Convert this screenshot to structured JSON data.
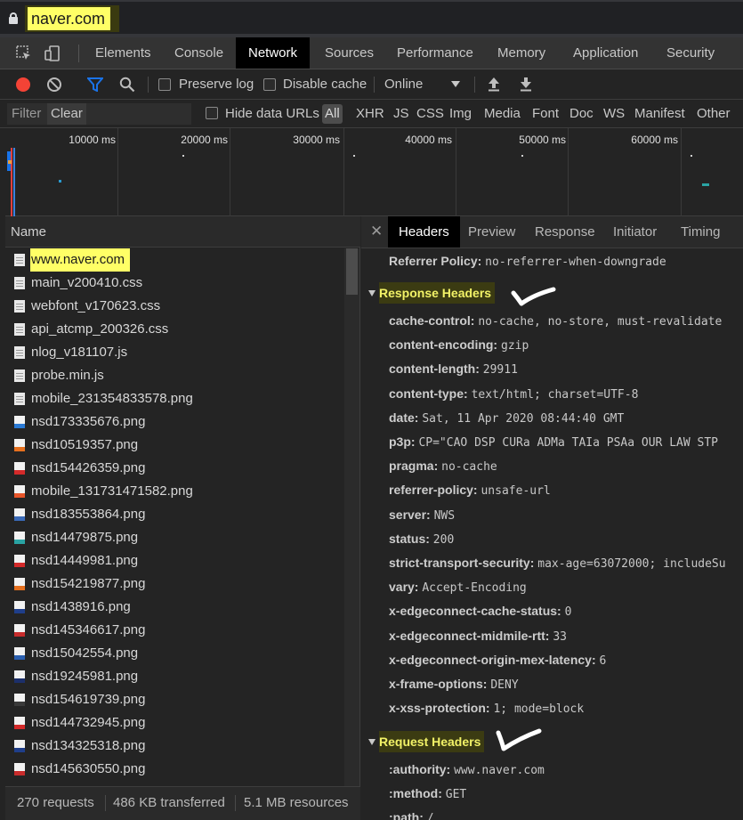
{
  "browser": {
    "url": "naver.com"
  },
  "devtools_tabs": [
    "Elements",
    "Console",
    "Network",
    "Sources",
    "Performance",
    "Memory",
    "Application",
    "Security"
  ],
  "active_tab": "Network",
  "toolbar": {
    "preserve_log": "Preserve log",
    "disable_cache": "Disable cache",
    "throttle": "Online"
  },
  "filter": {
    "placeholder": "Filter",
    "clear": "Clear",
    "hide_data_urls": "Hide data URLs",
    "types": [
      "All",
      "XHR",
      "JS",
      "CSS",
      "Img",
      "Media",
      "Font",
      "Doc",
      "WS",
      "Manifest",
      "Other"
    ],
    "selected": "All"
  },
  "overview": {
    "ticks": [
      "10000 ms",
      "20000 ms",
      "30000 ms",
      "40000 ms",
      "50000 ms",
      "60000 ms"
    ]
  },
  "requests": {
    "column": "Name",
    "items": [
      {
        "name": "www.naver.com",
        "icon": "document-icon"
      },
      {
        "name": "main_v200410.css",
        "icon": "document-icon"
      },
      {
        "name": "webfont_v170623.css",
        "icon": "document-icon"
      },
      {
        "name": "api_atcmp_200326.css",
        "icon": "document-icon"
      },
      {
        "name": "nlog_v181107.js",
        "icon": "document-icon"
      },
      {
        "name": "probe.min.js",
        "icon": "document-icon"
      },
      {
        "name": "mobile_231354833578.png",
        "icon": "document-icon"
      },
      {
        "name": "nsd173335676.png",
        "icon": "image-thumb-icon",
        "color": "#2a7ad5"
      },
      {
        "name": "nsd10519357.png",
        "icon": "image-thumb-icon",
        "color": "#e6701e"
      },
      {
        "name": "nsd154426359.png",
        "icon": "image-thumb-icon",
        "color": "#d42a2a"
      },
      {
        "name": "mobile_131731471582.png",
        "icon": "image-thumb-icon",
        "color": "#e8552a"
      },
      {
        "name": "nsd183553864.png",
        "icon": "image-thumb-icon",
        "color": "#3a6ab8"
      },
      {
        "name": "nsd14479875.png",
        "icon": "image-thumb-icon",
        "color": "#2aa3a3"
      },
      {
        "name": "nsd14449981.png",
        "icon": "image-thumb-icon",
        "color": "#d42a2a"
      },
      {
        "name": "nsd154219877.png",
        "icon": "image-thumb-icon",
        "color": "#e6701e"
      },
      {
        "name": "nsd1438916.png",
        "icon": "image-thumb-icon",
        "color": "#1f3e8a"
      },
      {
        "name": "nsd145346617.png",
        "icon": "image-thumb-icon",
        "color": "#c82c2c"
      },
      {
        "name": "nsd15042554.png",
        "icon": "image-thumb-icon",
        "color": "#2a5fb0"
      },
      {
        "name": "nsd19245981.png",
        "icon": "image-thumb-icon",
        "color": "#1c2f6a"
      },
      {
        "name": "nsd154619739.png",
        "icon": "image-thumb-icon",
        "color": "#3a3a3a"
      },
      {
        "name": "nsd144732945.png",
        "icon": "image-thumb-icon",
        "color": "#d42a2a"
      },
      {
        "name": "nsd134325318.png",
        "icon": "image-thumb-icon",
        "color": "#1f3e8a"
      },
      {
        "name": "nsd145630550.png",
        "icon": "image-thumb-icon",
        "color": "#c82c2c"
      }
    ]
  },
  "status": {
    "requests": "270 requests",
    "transferred": "486 KB transferred",
    "resources": "5.1 MB resources"
  },
  "detail": {
    "tabs": [
      "Headers",
      "Preview",
      "Response",
      "Initiator",
      "Timing"
    ],
    "active": "Headers",
    "referrer_policy": {
      "key": "Referrer Policy:",
      "value": "no-referrer-when-downgrade"
    },
    "response_headers_title": "Response Headers",
    "response_headers": [
      {
        "key": "cache-control:",
        "value": "no-cache, no-store, must-revalidate"
      },
      {
        "key": "content-encoding:",
        "value": "gzip"
      },
      {
        "key": "content-length:",
        "value": "29911"
      },
      {
        "key": "content-type:",
        "value": "text/html; charset=UTF-8"
      },
      {
        "key": "date:",
        "value": "Sat, 11 Apr 2020 08:44:40 GMT"
      },
      {
        "key": "p3p:",
        "value": "CP=\"CAO DSP CURa ADMa TAIa PSAa OUR LAW STP"
      },
      {
        "key": "pragma:",
        "value": "no-cache"
      },
      {
        "key": "referrer-policy:",
        "value": "unsafe-url"
      },
      {
        "key": "server:",
        "value": "NWS"
      },
      {
        "key": "status:",
        "value": "200"
      },
      {
        "key": "strict-transport-security:",
        "value": "max-age=63072000; includeSu"
      },
      {
        "key": "vary:",
        "value": "Accept-Encoding"
      },
      {
        "key": "x-edgeconnect-cache-status:",
        "value": "0"
      },
      {
        "key": "x-edgeconnect-midmile-rtt:",
        "value": "33"
      },
      {
        "key": "x-edgeconnect-origin-mex-latency:",
        "value": "6"
      },
      {
        "key": "x-frame-options:",
        "value": "DENY"
      },
      {
        "key": "x-xss-protection:",
        "value": "1; mode=block"
      }
    ],
    "request_headers_title": "Request Headers",
    "request_headers": [
      {
        "key": ":authority:",
        "value": "www.naver.com"
      },
      {
        "key": ":method:",
        "value": "GET"
      },
      {
        "key": ":path:",
        "value": "/"
      }
    ]
  },
  "colors": {
    "highlight": "#ffff66",
    "accent": "#1a73e8",
    "record": "#f44336",
    "section_title": "#f2f267"
  }
}
